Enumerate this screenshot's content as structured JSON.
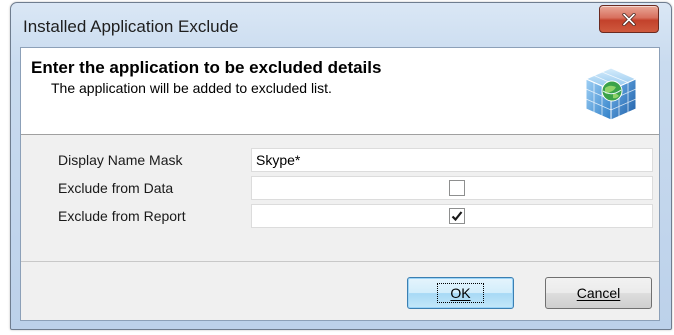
{
  "window": {
    "title": "Installed Application Exclude"
  },
  "header": {
    "title": "Enter the application to be excluded details",
    "subtitle": "The application will be added to excluded list.",
    "icon": "globe-grid-icon"
  },
  "form": {
    "display_name_mask": {
      "label": "Display Name Mask",
      "value": "Skype*"
    },
    "exclude_from_data": {
      "label": "Exclude from Data",
      "checked": false
    },
    "exclude_from_report": {
      "label": "Exclude from Report",
      "checked": true
    }
  },
  "buttons": {
    "ok_label": "OK",
    "cancel_label": "Cancel"
  },
  "colors": {
    "close_button": "#c94a33",
    "ok_button_border": "#3c7fb1",
    "header_background": "#ffffff",
    "client_background": "#f0f0f0"
  }
}
